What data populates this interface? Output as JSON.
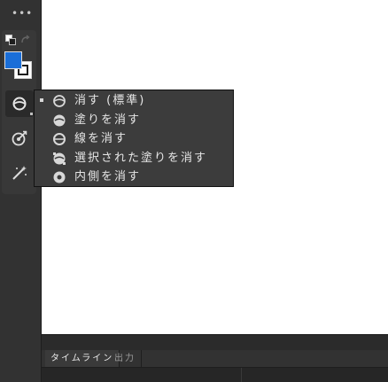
{
  "toolbar": {
    "more_glyph": "•••",
    "fill_color": "#1a6ed8",
    "stroke_color": "#ffffff",
    "tools": [
      {
        "name": "eraser-tool",
        "icon": "eraser-icon"
      },
      {
        "name": "paint-bucket-tool",
        "icon": "paint-target-icon"
      },
      {
        "name": "magic-wand-tool",
        "icon": "magic-wand-icon"
      }
    ]
  },
  "flyout": {
    "items": [
      {
        "label": "消す (標準)",
        "icon": "erase-normal-icon",
        "selected": true
      },
      {
        "label": "塗りを消す",
        "icon": "erase-fills-icon",
        "selected": false
      },
      {
        "label": "線を消す",
        "icon": "erase-lines-icon",
        "selected": false
      },
      {
        "label": "選択された塗りを消す",
        "icon": "erase-selected-fills-icon",
        "selected": false
      },
      {
        "label": "内側を消す",
        "icon": "erase-inside-icon",
        "selected": false
      }
    ]
  },
  "timeline": {
    "tabs": [
      "タイムライン",
      "出力"
    ]
  },
  "colors": {
    "panel_bg": "#323232",
    "menu_bg": "#3c3c3c",
    "accent_blue": "#1a6ed8"
  }
}
